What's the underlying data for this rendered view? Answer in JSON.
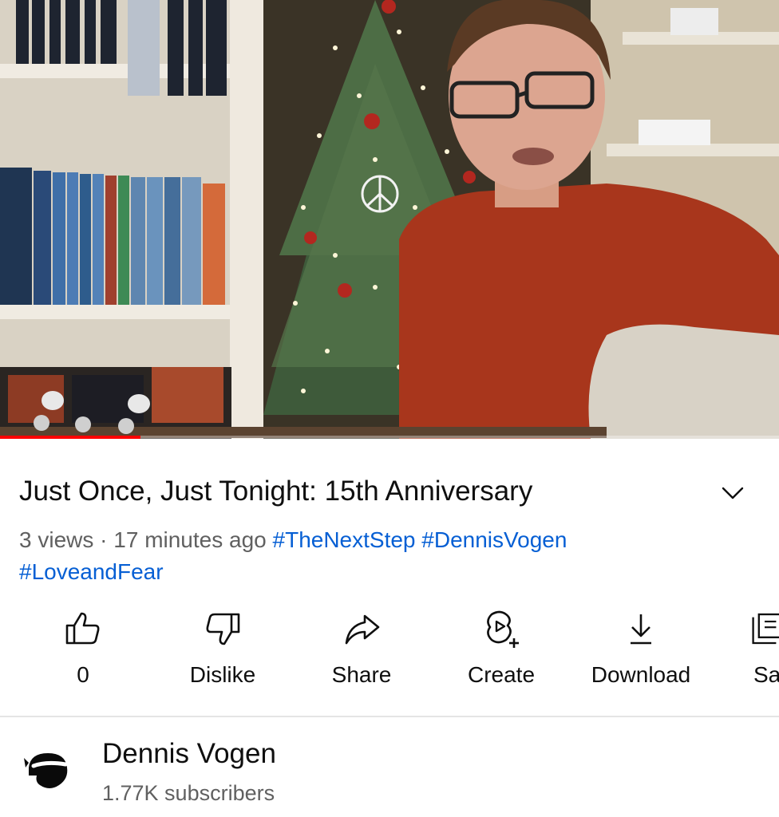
{
  "video": {
    "description": "",
    "progress_fraction": 0.18
  },
  "details": {
    "title": "Just Once, Just Tonight: 15th Anniversary",
    "views": "3 views",
    "separator": "·",
    "age": "17 minutes ago",
    "hashtags_line1": [
      "#TheNextStep",
      "#DennisVogen"
    ],
    "hashtags_line2": [
      "#LoveandFear"
    ]
  },
  "actions": {
    "like_count": "0",
    "dislike": "Dislike",
    "share": "Share",
    "create": "Create",
    "download": "Download",
    "save": "Sa"
  },
  "channel": {
    "name": "Dennis Vogen",
    "subscribers": "1.77K subscribers"
  },
  "colors": {
    "progress": "#ff0000",
    "hashtag": "#065fd4",
    "muted": "#606060",
    "text": "#0f0f0f"
  },
  "icons": {
    "expand": "chevron-down-icon",
    "like": "thumbs-up-icon",
    "dislike": "thumbs-down-icon",
    "share": "share-arrow-icon",
    "create": "create-plus-icon",
    "download": "download-icon",
    "save": "save-playlist-icon",
    "avatar": "channel-avatar"
  }
}
